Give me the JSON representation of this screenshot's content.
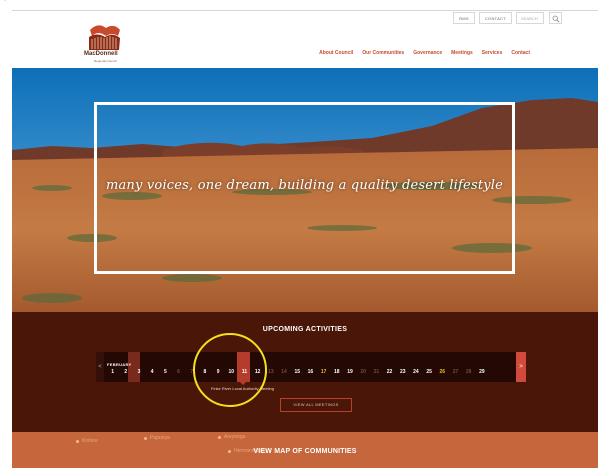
{
  "header": {
    "utility_links": [
      "RMS",
      "CONTACT"
    ],
    "search_placeholder": "SEARCH",
    "logo_title": "MacDonnell",
    "logo_subtitle": "Regional Council",
    "nav": [
      "About Council",
      "Our Communities",
      "Governance",
      "Meetings",
      "Services",
      "Contact"
    ]
  },
  "hero": {
    "tagline": "many voices, one dream, building a quality desert lifestyle"
  },
  "activities": {
    "title": "UPCOMING ACTIVITIES",
    "month": "FEBRUARY",
    "days": [
      "1",
      "2",
      "3",
      "4",
      "5",
      "6",
      "7",
      "8",
      "9",
      "10",
      "11",
      "12",
      "13",
      "14",
      "15",
      "16",
      "17",
      "18",
      "19",
      "20",
      "21",
      "22",
      "23",
      "24",
      "25",
      "26",
      "27",
      "28",
      "29"
    ],
    "selected_day": "10",
    "tooltip": "Finke River Local Authority Meeting",
    "view_all_label": "VIEW ALL MEETINGS",
    "next_arrow": ">",
    "prev_arrow": "<"
  },
  "map": {
    "title": "VIEW MAP OF COMMUNITIES",
    "locations": [
      "Kintore",
      "Papunya",
      "Areyonga",
      "Hermannsburg"
    ]
  },
  "colors": {
    "brand": "#c84a2d",
    "activities_bg": "#4a1608",
    "map_bg": "#c6663c",
    "highlight": "#f5e11b"
  }
}
